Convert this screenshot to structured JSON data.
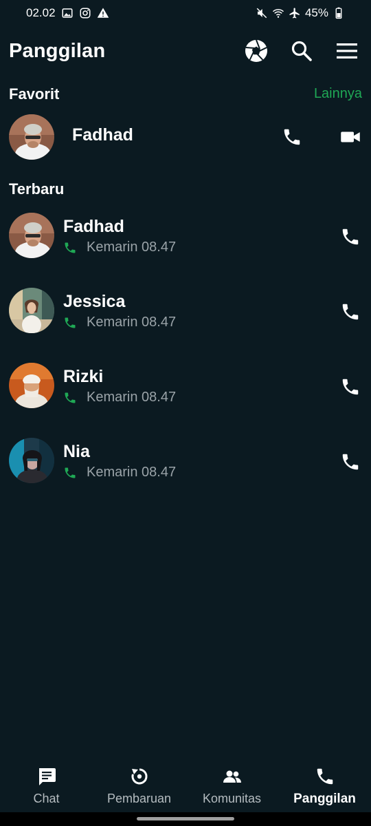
{
  "status_bar": {
    "time": "02.02",
    "battery": "45%"
  },
  "app_bar": {
    "title": "Panggilan",
    "actions": [
      "camera-shutter-icon",
      "search-icon",
      "menu-icon"
    ]
  },
  "favorites": {
    "header": "Favorit",
    "more_label": "Lainnya",
    "items": [
      {
        "name": "Fadhad"
      }
    ]
  },
  "recent": {
    "header": "Terbaru",
    "items": [
      {
        "name": "Fadhad",
        "time": "Kemarin 08.47"
      },
      {
        "name": "Jessica",
        "time": "Kemarin 08.47"
      },
      {
        "name": "Rizki",
        "time": "Kemarin 08.47"
      },
      {
        "name": "Nia",
        "time": "Kemarin 08.47"
      }
    ]
  },
  "bottom_nav": {
    "items": [
      {
        "label": "Chat",
        "icon": "chat-icon",
        "active": false
      },
      {
        "label": "Pembaruan",
        "icon": "updates-icon",
        "active": false
      },
      {
        "label": "Komunitas",
        "icon": "communities-icon",
        "active": false
      },
      {
        "label": "Panggilan",
        "icon": "calls-icon",
        "active": true
      }
    ]
  },
  "colors": {
    "background": "#0b1a21",
    "accent": "#1fa855",
    "text_secondary": "#9aa3a8"
  }
}
